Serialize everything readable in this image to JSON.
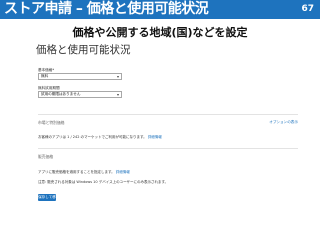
{
  "slide": {
    "title": "ストア申請 – 価格と使用可能状況",
    "page_number": "67",
    "subtitle": "価格や公開する地域(国)などを設定",
    "header_color": "#1e73be"
  },
  "panel": {
    "title": "価格と使用可能状況"
  },
  "pricing": {
    "base_price_label": "基本価格*",
    "base_price_value": "無料",
    "trial_label": "無料試用期間",
    "trial_value": "試用の期限はありません"
  },
  "markets": {
    "title": "市場と特別価格",
    "show_options_link": "オプションの表示",
    "description": "お客様のアプリは 1 / 242 のマーケットでご利用が可能になります。",
    "details_link": "詳細情報"
  },
  "distribution": {
    "title": "販売価格",
    "line1": "アプリに販売価格を適用することを指定します。",
    "line1_link": "詳細情報",
    "line2": "注意: 販売される対象は Windows 10 デバイス上のユーザーにのみ表示されます。",
    "save_label": "保存して移動"
  },
  "colors": {
    "accent": "#1e73be",
    "link": "#1e73be"
  }
}
